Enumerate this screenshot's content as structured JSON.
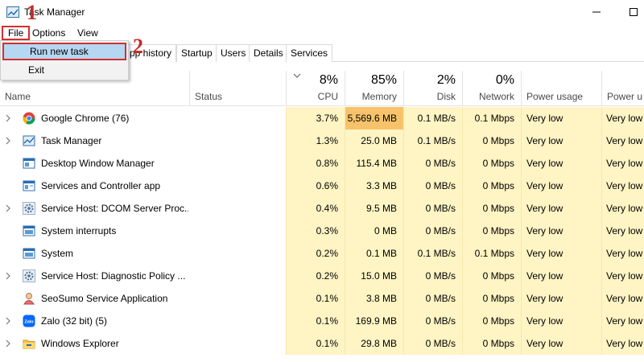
{
  "window": {
    "title": "Task Manager"
  },
  "menu": {
    "file": "File",
    "options": "Options",
    "view": "View"
  },
  "file_menu": {
    "run_new_task": "Run new task",
    "exit": "Exit"
  },
  "steps": {
    "one": "1",
    "two": "2"
  },
  "tabs": [
    "pp history",
    "Startup",
    "Users",
    "Details",
    "Services"
  ],
  "columns": {
    "name": "Name",
    "status": "Status",
    "cpu": {
      "pct": "8%",
      "label": "CPU"
    },
    "memory": {
      "pct": "85%",
      "label": "Memory"
    },
    "disk": {
      "pct": "2%",
      "label": "Disk"
    },
    "network": {
      "pct": "0%",
      "label": "Network"
    },
    "power_usage": "Power usage",
    "power_usage_trend": "Power u"
  },
  "processes": [
    {
      "name": "Google Chrome (76)",
      "icon": "chrome-icon",
      "expandable": true,
      "cpu": "3.7%",
      "memory": "5,569.6 MB",
      "disk": "0.1 MB/s",
      "network": "0.1 Mbps",
      "power": "Very low",
      "power_trend": "Very low"
    },
    {
      "name": "Task Manager",
      "icon": "task-manager-icon",
      "expandable": true,
      "cpu": "1.3%",
      "memory": "25.0 MB",
      "disk": "0.1 MB/s",
      "network": "0 Mbps",
      "power": "Very low",
      "power_trend": "Very low"
    },
    {
      "name": "Desktop Window Manager",
      "icon": "dwm-icon",
      "expandable": false,
      "cpu": "0.8%",
      "memory": "115.4 MB",
      "disk": "0 MB/s",
      "network": "0 Mbps",
      "power": "Very low",
      "power_trend": "Very low"
    },
    {
      "name": "Services and Controller app",
      "icon": "services-icon",
      "expandable": false,
      "cpu": "0.6%",
      "memory": "3.3 MB",
      "disk": "0 MB/s",
      "network": "0 Mbps",
      "power": "Very low",
      "power_trend": "Very low"
    },
    {
      "name": "Service Host: DCOM Server Proc...",
      "icon": "gear-icon",
      "expandable": true,
      "cpu": "0.4%",
      "memory": "9.5 MB",
      "disk": "0 MB/s",
      "network": "0 Mbps",
      "power": "Very low",
      "power_trend": "Very low"
    },
    {
      "name": "System interrupts",
      "icon": "system-icon",
      "expandable": false,
      "cpu": "0.3%",
      "memory": "0 MB",
      "disk": "0 MB/s",
      "network": "0 Mbps",
      "power": "Very low",
      "power_trend": "Very low"
    },
    {
      "name": "System",
      "icon": "system-icon",
      "expandable": false,
      "cpu": "0.2%",
      "memory": "0.1 MB",
      "disk": "0.1 MB/s",
      "network": "0.1 Mbps",
      "power": "Very low",
      "power_trend": "Very low"
    },
    {
      "name": "Service Host: Diagnostic Policy ...",
      "icon": "gear-icon",
      "expandable": true,
      "cpu": "0.2%",
      "memory": "15.0 MB",
      "disk": "0 MB/s",
      "network": "0 Mbps",
      "power": "Very low",
      "power_trend": "Very low"
    },
    {
      "name": "SeoSumo Service Application",
      "icon": "seosumo-icon",
      "expandable": false,
      "cpu": "0.1%",
      "memory": "3.8 MB",
      "disk": "0 MB/s",
      "network": "0 Mbps",
      "power": "Very low",
      "power_trend": "Very low"
    },
    {
      "name": "Zalo (32 bit) (5)",
      "icon": "zalo-icon",
      "expandable": true,
      "cpu": "0.1%",
      "memory": "169.9 MB",
      "disk": "0 MB/s",
      "network": "0 Mbps",
      "power": "Very low",
      "power_trend": "Very low"
    },
    {
      "name": "Windows Explorer",
      "icon": "folder-icon",
      "expandable": true,
      "cpu": "0.1%",
      "memory": "29.8 MB",
      "disk": "0 MB/s",
      "network": "0 Mbps",
      "power": "Very low",
      "power_trend": "Very low"
    }
  ],
  "colors": {
    "heat_low": "#fff4c4",
    "heat_high": "#f7c36a",
    "highlight_border": "#d32f2f",
    "selection": "#b6d7f2"
  }
}
